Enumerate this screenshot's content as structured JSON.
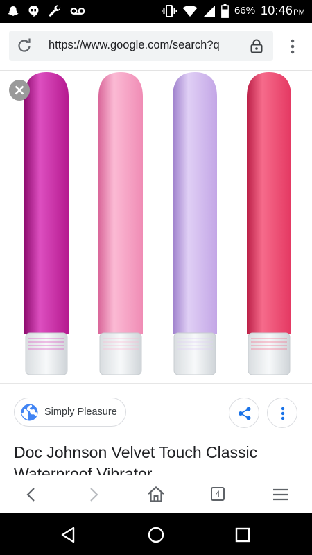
{
  "status_bar": {
    "battery": "66%",
    "time": "10:46",
    "ampm": "PM",
    "left_icons": [
      "snapchat-icon",
      "hangouts-icon",
      "wrench-icon",
      "voicemail-icon"
    ],
    "right_icons": [
      "vibrate-icon",
      "wifi-icon",
      "signal-icon",
      "battery-icon"
    ]
  },
  "address_bar": {
    "url": "https://www.google.com/search?q",
    "icons": [
      "reload-icon",
      "lock-icon",
      "menu-icon"
    ]
  },
  "image_viewer": {
    "products": [
      {
        "color_main": "#b5198f",
        "color_light": "#dd4fc0",
        "color_dark": "#8f0c70"
      },
      {
        "color_main": "#f08cb5",
        "color_light": "#fbbad4",
        "color_dark": "#d9679a"
      },
      {
        "color_main": "#c3a6e6",
        "color_light": "#e0cff5",
        "color_dark": "#9e80cc"
      },
      {
        "color_main": "#e43862",
        "color_light": "#f66b8b",
        "color_dark": "#bb1f47"
      }
    ]
  },
  "result": {
    "source": "Simply Pleasure",
    "title": "Doc Johnson Velvet Touch Classic Waterproof Vibrator"
  },
  "browser_bar": {
    "tab_count": "4"
  },
  "colors": {
    "globe_blue": "#4285f4",
    "action_blue": "#1a73e8",
    "icon_gray": "#5f6368"
  }
}
